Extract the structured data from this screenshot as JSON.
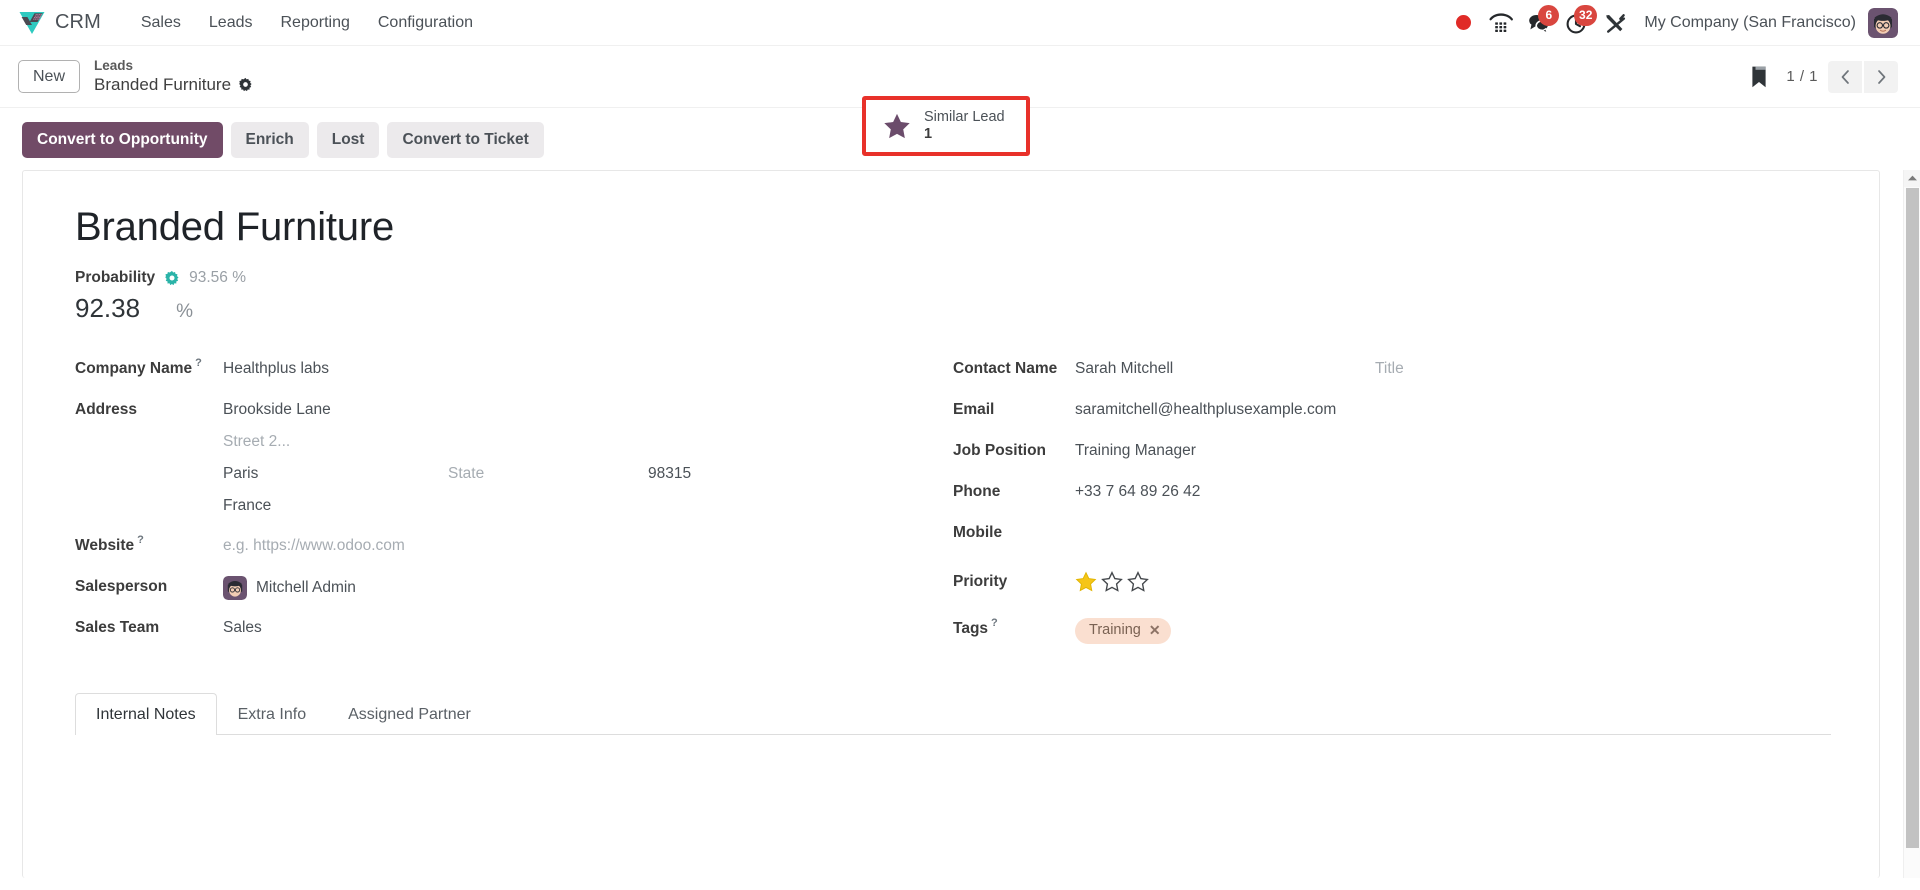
{
  "navbar": {
    "brand": "CRM",
    "menu": [
      {
        "label": "Sales"
      },
      {
        "label": "Leads"
      },
      {
        "label": "Reporting"
      },
      {
        "label": "Configuration"
      }
    ],
    "systray": {
      "recording_icon": "record-dot-icon",
      "dialpad_icon": "phone-dialpad-icon",
      "messages_icon": "messages-icon",
      "messages_badge": "6",
      "activities_icon": "clock-activities-icon",
      "activities_badge": "32",
      "tools_icon": "tools-icon",
      "company": "My Company (San Francisco)",
      "avatar_icon": "user-avatar"
    }
  },
  "control_panel": {
    "new_button": "New",
    "breadcrumb_parent": "Leads",
    "breadcrumb_current": "Branded Furniture",
    "settings_icon": "gear-icon",
    "stat_button": {
      "icon": "star-icon",
      "label": "Similar Lead",
      "value": "1",
      "highlight_color": "#e8312a"
    },
    "bookmark_icon": "bookmark-icon",
    "pager": "1 / 1",
    "prev_icon": "chevron-left-icon",
    "next_icon": "chevron-right-icon"
  },
  "actions": {
    "primary": "Convert to Opportunity",
    "secondary": [
      "Enrich",
      "Lost",
      "Convert to Ticket"
    ],
    "primary_color": "#714b67"
  },
  "record": {
    "title": "Branded Furniture",
    "probability": {
      "label": "Probability",
      "auto_icon": "gear-icon",
      "auto_value": "93.56 %",
      "value": "92.38",
      "unit": "%"
    },
    "left_fields": {
      "company_name_label": "Company Name",
      "company_name_value": "Healthplus labs",
      "address_label": "Address",
      "street": "Brookside Lane",
      "street2_placeholder": "Street 2...",
      "city": "Paris",
      "state_placeholder": "State",
      "zip": "98315",
      "country": "France",
      "website_label": "Website",
      "website_placeholder": "e.g. https://www.odoo.com",
      "salesperson_label": "Salesperson",
      "salesperson_value": "Mitchell Admin",
      "sales_team_label": "Sales Team",
      "sales_team_value": "Sales"
    },
    "right_fields": {
      "contact_name_label": "Contact Name",
      "contact_name_value": "Sarah Mitchell",
      "title_placeholder": "Title",
      "email_label": "Email",
      "email_value": "saramitchell@healthplusexample.com",
      "job_position_label": "Job Position",
      "job_position_value": "Training Manager",
      "phone_label": "Phone",
      "phone_value": "+33 7 64 89 26 42",
      "mobile_label": "Mobile",
      "mobile_value": "",
      "priority_label": "Priority",
      "priority_filled": 1,
      "priority_total": 3,
      "priority_color": "#f5c518",
      "tags_label": "Tags",
      "tags": [
        {
          "name": "Training",
          "color": "#fadfd0"
        }
      ]
    }
  },
  "notebook": {
    "tabs": [
      {
        "label": "Internal Notes",
        "active": true
      },
      {
        "label": "Extra Info",
        "active": false
      },
      {
        "label": "Assigned Partner",
        "active": false
      }
    ]
  }
}
